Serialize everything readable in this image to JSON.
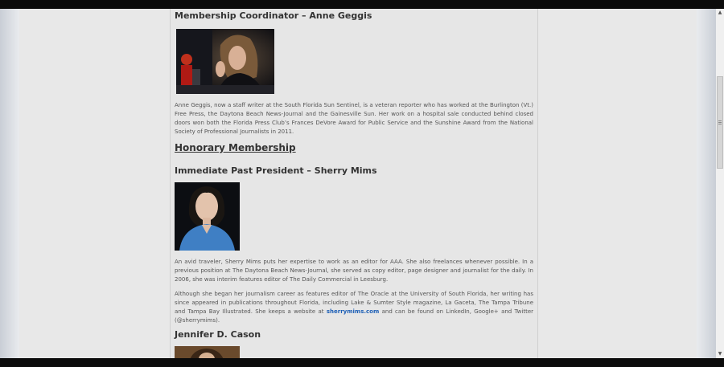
{
  "page": {
    "sections": {
      "coordinator": {
        "heading": "Membership Coordinator – Anne Geggis",
        "bio": "Anne Geggis, now a staff writer at the South Florida Sun Sentinel, is a veteran reporter who has worked at the Burlington (Vt.) Free Press, the Daytona Beach News-Journal and the Gainesville Sun. Her work on a hospital sale conducted behind closed doors won both the Florida Press Club’s Frances DeVore Award for Public Service and the Sunshine Award from the National Society of Professional Journalists in 2011."
      },
      "honorary": {
        "title": "Honorary Membership"
      },
      "past_president": {
        "heading": "Immediate Past President – Sherry Mims",
        "bio1": "An avid traveler, Sherry Mims puts her expertise to work as an editor for AAA. She also freelances whenever possible. In a previous position at The Daytona Beach News-Journal, she served as copy editor, page designer and journalist for the daily. In 2006, she was interim features editor of The Daily Commercial in Leesburg.",
        "bio2_before": "Although she began her journalism career as features editor of The Oracle at the University of South Florida, her writing has since appeared in publications throughout Florida, including Lake & Sumter Style magazine, La Gaceta, The Tampa Tribune and Tampa Bay Illustrated. She keeps a website at ",
        "bio2_link": "sherrymims.com",
        "bio2_after": " and can be found on LinkedIn, Google+ and Twitter (@sherrymims)."
      },
      "cason": {
        "heading": "Jennifer D. Cason"
      }
    }
  },
  "scrollbar": {
    "up_icon": "arrow-up-icon",
    "down_icon": "arrow-down-icon"
  },
  "colors": {
    "link": "#1d5fb6",
    "content_bg": "#e6e6e6",
    "chrome": "#0b0b0b"
  }
}
